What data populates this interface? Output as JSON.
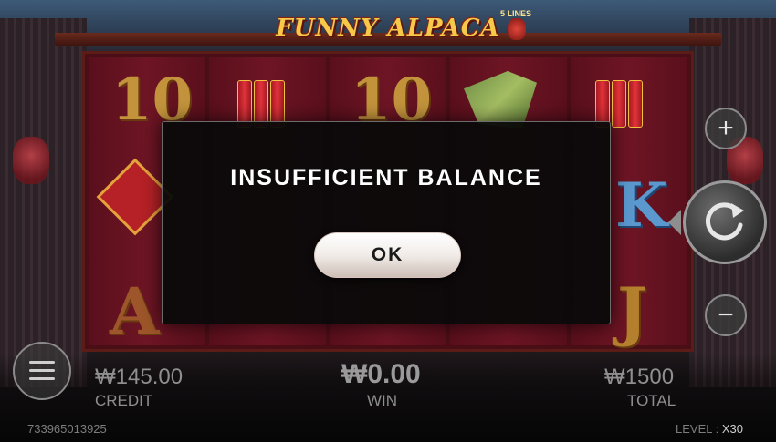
{
  "game": {
    "title": "FUNNY ALPACA",
    "lines_badge": "5 LINES"
  },
  "modal": {
    "message": "INSUFFICIENT BALANCE",
    "ok_label": "OK"
  },
  "reels": {
    "symbols_visible": [
      "10",
      "10",
      "K",
      "A",
      "J"
    ]
  },
  "controls": {
    "plus_label": "+",
    "minus_label": "−",
    "spin_icon": "spin-refresh-icon",
    "menu_icon": "hamburger-menu-icon"
  },
  "stats": {
    "credit_value": "₩145.00",
    "credit_label": "CREDIT",
    "win_value": "₩0.00",
    "win_label": "WIN",
    "total_value": "₩1500",
    "total_label": "TOTAL"
  },
  "footer": {
    "session_id": "733965013925",
    "level_label": "LEVEL :",
    "level_value": "X30"
  }
}
